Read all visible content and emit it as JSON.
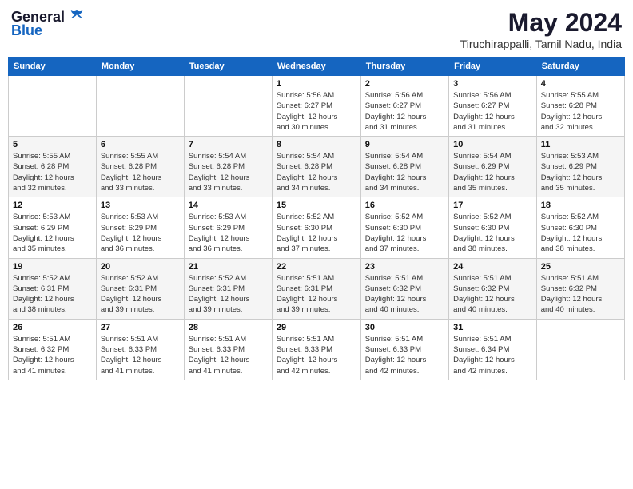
{
  "logo": {
    "general": "General",
    "blue": "Blue"
  },
  "title": "May 2024",
  "location": "Tiruchirappalli, Tamil Nadu, India",
  "weekdays": [
    "Sunday",
    "Monday",
    "Tuesday",
    "Wednesday",
    "Thursday",
    "Friday",
    "Saturday"
  ],
  "weeks": [
    [
      {
        "day": "",
        "info": ""
      },
      {
        "day": "",
        "info": ""
      },
      {
        "day": "",
        "info": ""
      },
      {
        "day": "1",
        "info": "Sunrise: 5:56 AM\nSunset: 6:27 PM\nDaylight: 12 hours\nand 30 minutes."
      },
      {
        "day": "2",
        "info": "Sunrise: 5:56 AM\nSunset: 6:27 PM\nDaylight: 12 hours\nand 31 minutes."
      },
      {
        "day": "3",
        "info": "Sunrise: 5:56 AM\nSunset: 6:27 PM\nDaylight: 12 hours\nand 31 minutes."
      },
      {
        "day": "4",
        "info": "Sunrise: 5:55 AM\nSunset: 6:28 PM\nDaylight: 12 hours\nand 32 minutes."
      }
    ],
    [
      {
        "day": "5",
        "info": "Sunrise: 5:55 AM\nSunset: 6:28 PM\nDaylight: 12 hours\nand 32 minutes."
      },
      {
        "day": "6",
        "info": "Sunrise: 5:55 AM\nSunset: 6:28 PM\nDaylight: 12 hours\nand 33 minutes."
      },
      {
        "day": "7",
        "info": "Sunrise: 5:54 AM\nSunset: 6:28 PM\nDaylight: 12 hours\nand 33 minutes."
      },
      {
        "day": "8",
        "info": "Sunrise: 5:54 AM\nSunset: 6:28 PM\nDaylight: 12 hours\nand 34 minutes."
      },
      {
        "day": "9",
        "info": "Sunrise: 5:54 AM\nSunset: 6:28 PM\nDaylight: 12 hours\nand 34 minutes."
      },
      {
        "day": "10",
        "info": "Sunrise: 5:54 AM\nSunset: 6:29 PM\nDaylight: 12 hours\nand 35 minutes."
      },
      {
        "day": "11",
        "info": "Sunrise: 5:53 AM\nSunset: 6:29 PM\nDaylight: 12 hours\nand 35 minutes."
      }
    ],
    [
      {
        "day": "12",
        "info": "Sunrise: 5:53 AM\nSunset: 6:29 PM\nDaylight: 12 hours\nand 35 minutes."
      },
      {
        "day": "13",
        "info": "Sunrise: 5:53 AM\nSunset: 6:29 PM\nDaylight: 12 hours\nand 36 minutes."
      },
      {
        "day": "14",
        "info": "Sunrise: 5:53 AM\nSunset: 6:29 PM\nDaylight: 12 hours\nand 36 minutes."
      },
      {
        "day": "15",
        "info": "Sunrise: 5:52 AM\nSunset: 6:30 PM\nDaylight: 12 hours\nand 37 minutes."
      },
      {
        "day": "16",
        "info": "Sunrise: 5:52 AM\nSunset: 6:30 PM\nDaylight: 12 hours\nand 37 minutes."
      },
      {
        "day": "17",
        "info": "Sunrise: 5:52 AM\nSunset: 6:30 PM\nDaylight: 12 hours\nand 38 minutes."
      },
      {
        "day": "18",
        "info": "Sunrise: 5:52 AM\nSunset: 6:30 PM\nDaylight: 12 hours\nand 38 minutes."
      }
    ],
    [
      {
        "day": "19",
        "info": "Sunrise: 5:52 AM\nSunset: 6:31 PM\nDaylight: 12 hours\nand 38 minutes."
      },
      {
        "day": "20",
        "info": "Sunrise: 5:52 AM\nSunset: 6:31 PM\nDaylight: 12 hours\nand 39 minutes."
      },
      {
        "day": "21",
        "info": "Sunrise: 5:52 AM\nSunset: 6:31 PM\nDaylight: 12 hours\nand 39 minutes."
      },
      {
        "day": "22",
        "info": "Sunrise: 5:51 AM\nSunset: 6:31 PM\nDaylight: 12 hours\nand 39 minutes."
      },
      {
        "day": "23",
        "info": "Sunrise: 5:51 AM\nSunset: 6:32 PM\nDaylight: 12 hours\nand 40 minutes."
      },
      {
        "day": "24",
        "info": "Sunrise: 5:51 AM\nSunset: 6:32 PM\nDaylight: 12 hours\nand 40 minutes."
      },
      {
        "day": "25",
        "info": "Sunrise: 5:51 AM\nSunset: 6:32 PM\nDaylight: 12 hours\nand 40 minutes."
      }
    ],
    [
      {
        "day": "26",
        "info": "Sunrise: 5:51 AM\nSunset: 6:32 PM\nDaylight: 12 hours\nand 41 minutes."
      },
      {
        "day": "27",
        "info": "Sunrise: 5:51 AM\nSunset: 6:33 PM\nDaylight: 12 hours\nand 41 minutes."
      },
      {
        "day": "28",
        "info": "Sunrise: 5:51 AM\nSunset: 6:33 PM\nDaylight: 12 hours\nand 41 minutes."
      },
      {
        "day": "29",
        "info": "Sunrise: 5:51 AM\nSunset: 6:33 PM\nDaylight: 12 hours\nand 42 minutes."
      },
      {
        "day": "30",
        "info": "Sunrise: 5:51 AM\nSunset: 6:33 PM\nDaylight: 12 hours\nand 42 minutes."
      },
      {
        "day": "31",
        "info": "Sunrise: 5:51 AM\nSunset: 6:34 PM\nDaylight: 12 hours\nand 42 minutes."
      },
      {
        "day": "",
        "info": ""
      }
    ]
  ]
}
